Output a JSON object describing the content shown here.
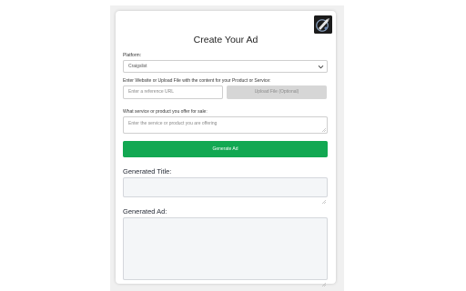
{
  "form": {
    "title": "Create Your Ad",
    "platform_label": "Platform:",
    "platform_value": "Craigslist",
    "source_label": "Enter Website or Upload File with the content for your Product or Service:",
    "url_placeholder": "Enter a reference URL",
    "upload_label": "Upload File (Optional)",
    "service_label": "What service or product you offer for sale:",
    "service_placeholder": "Enter the service or product you are offering",
    "generate_label": "Generate Ad",
    "generated_title_label": "Generated Title:",
    "generated_ad_label": "Generated Ad:"
  },
  "colors": {
    "accent_green": "#12a852",
    "upload_disabled": "#d6d6d6",
    "output_bg": "#f4f6f8"
  },
  "icons": {
    "logo": "app-logo-icon",
    "dropdown": "chevron-down-icon"
  }
}
